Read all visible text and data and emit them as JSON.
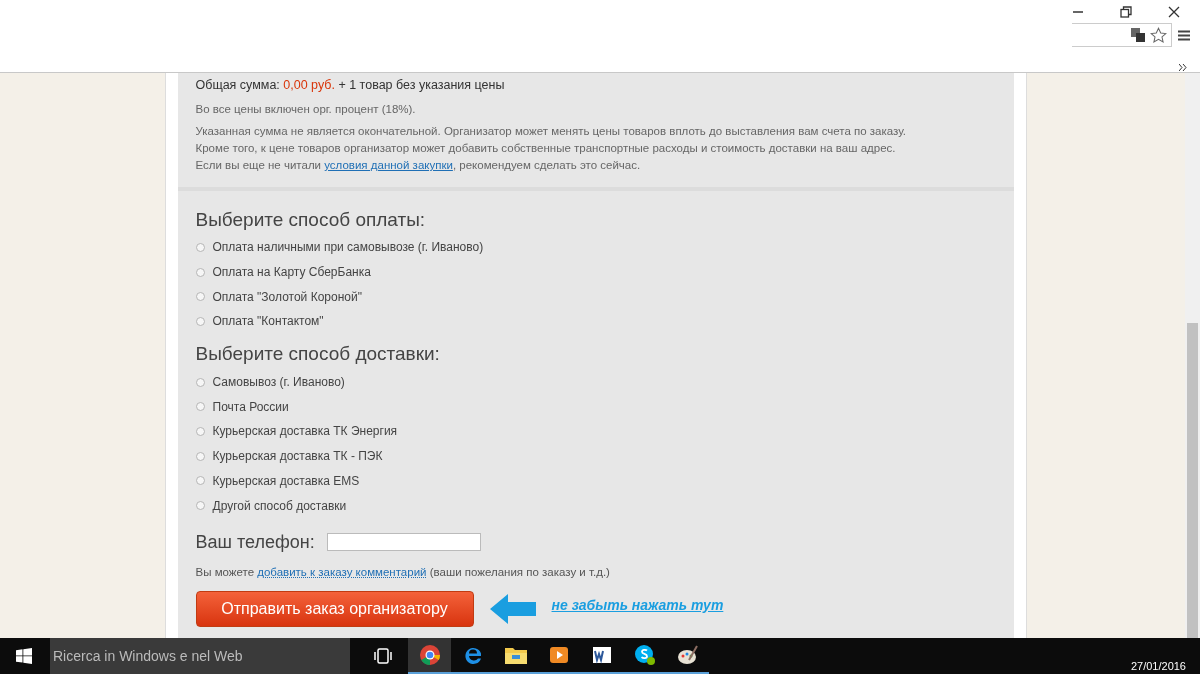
{
  "summary": {
    "label": "Общая сумма:",
    "amount": "0,00 руб.",
    "extra": "+ 1 товар без указания цены"
  },
  "notes": {
    "percent": "Во все цены включен орг. процент (18%).",
    "disclaimer_lines": [
      "Указанная сумма не является окончательной. Организатор может менять цены товаров вплоть до выставления вам счета по заказу.",
      "Кроме того, к цене товаров организатор может добавить собственные транспортные расходы и стоимость доставки на ваш адрес."
    ],
    "terms_before": "Если вы еще не читали",
    "terms_link": "условия данной закупки",
    "terms_after": ", рекомендуем сделать это сейчас."
  },
  "payment": {
    "heading": "Выберите способ оплаты:",
    "options": [
      {
        "label": "Оплата наличными при самовывозе (г. Иваново)",
        "selected": false
      },
      {
        "label": "Оплата на Карту СберБанка",
        "selected": false
      },
      {
        "label": "Оплата \"Золотой Короной\"",
        "selected": false
      },
      {
        "label": "Оплата \"Контактом\"",
        "selected": false
      }
    ]
  },
  "delivery": {
    "heading": "Выберите способ доставки:",
    "options": [
      {
        "label": "Самовывоз (г. Иваново)",
        "selected": false
      },
      {
        "label": "Почта России",
        "selected": false
      },
      {
        "label": "Курьерская доставка ТК Энергия",
        "selected": false
      },
      {
        "label": "Курьерская доставка ТК - ПЭК",
        "selected": false
      },
      {
        "label": "Курьерская доставка EMS",
        "selected": false
      },
      {
        "label": "Другой способ доставки",
        "selected": false
      }
    ]
  },
  "phone": {
    "label": "Ваш телефон:"
  },
  "comment": {
    "before": "Вы можете",
    "link": "добавить к заказу комментарий",
    "after": "(ваши пожелания по заказу и т.д.)"
  },
  "submit_button": "Отправить заказ организатору",
  "hint": "не забыть нажать тут",
  "taskbar": {
    "search_placeholder": "Ricerca in Windows e nel Web",
    "date": "27/01/2016"
  }
}
